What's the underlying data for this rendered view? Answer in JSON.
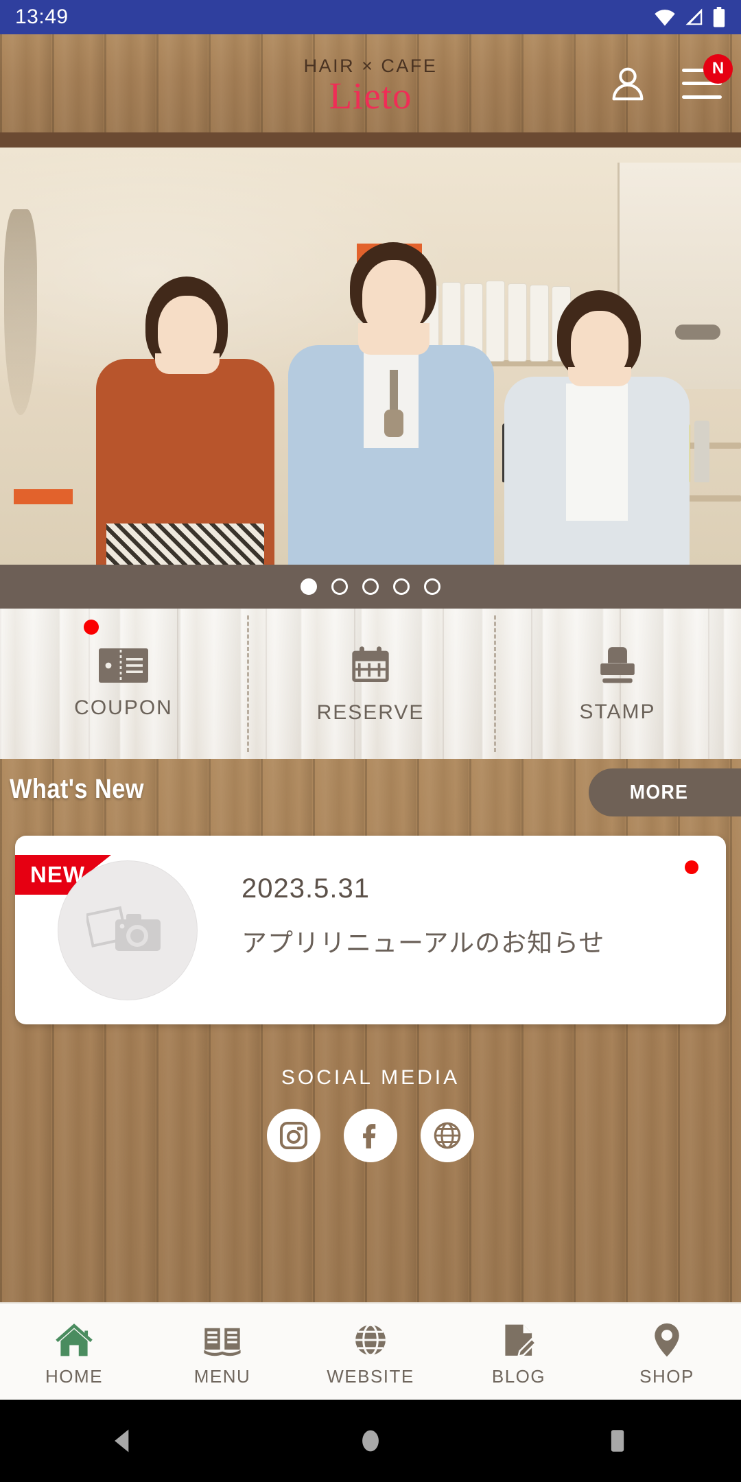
{
  "status_bar": {
    "time": "13:49",
    "icons": [
      "wifi-icon",
      "cellular-signal-icon",
      "battery-icon"
    ],
    "background": "#2f3f9e"
  },
  "header": {
    "logo_top": "HAIR × CAFE",
    "logo_main": "Lieto",
    "logo_main_color": "#ef2d56",
    "account_icon": "person-icon",
    "menu_icon": "hamburger-menu-icon",
    "menu_badge": "N",
    "menu_badge_color": "#e60012"
  },
  "hero": {
    "alt": "Three hair salon staff members standing in the salon",
    "carousel": {
      "total_dots": 5,
      "active_index": 0
    }
  },
  "quick_actions": [
    {
      "label": "COUPON",
      "icon": "coupon-ticket-icon",
      "badge": true
    },
    {
      "label": "RESERVE",
      "icon": "calendar-icon",
      "badge": false
    },
    {
      "label": "STAMP",
      "icon": "stamp-icon",
      "badge": false
    }
  ],
  "whats_new": {
    "title": "What's New",
    "more_label": "MORE",
    "more_color": "#6f6156",
    "items": [
      {
        "badge": "NEW",
        "badge_color": "#e60012",
        "date": "2023.5.31",
        "title": "アプリリニューアルのお知らせ",
        "thumb_icon": "photo-placeholder-icon",
        "unread": true
      }
    ]
  },
  "social": {
    "title": "SOCIAL MEDIA",
    "links": [
      {
        "name": "instagram-icon"
      },
      {
        "name": "facebook-icon"
      },
      {
        "name": "website-globe-icon"
      }
    ]
  },
  "bottom_nav": {
    "active_index": 0,
    "active_color": "#4a8c5f",
    "inactive_color": "#7d7163",
    "items": [
      {
        "label": "HOME",
        "icon": "home-icon"
      },
      {
        "label": "MENU",
        "icon": "book-icon"
      },
      {
        "label": "WEBSITE",
        "icon": "globe-icon"
      },
      {
        "label": "BLOG",
        "icon": "document-pencil-icon"
      },
      {
        "label": "SHOP",
        "icon": "map-pin-icon"
      }
    ]
  },
  "android_nav": {
    "buttons": [
      {
        "name": "back-button",
        "icon": "back-triangle-icon"
      },
      {
        "name": "home-button",
        "icon": "home-circle-icon"
      },
      {
        "name": "recents-button",
        "icon": "recents-square-icon"
      }
    ]
  }
}
